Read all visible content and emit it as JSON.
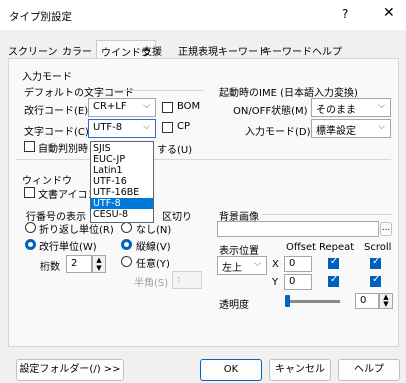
{
  "window": {
    "title": "タイプ別設定",
    "help": "?",
    "close": "✕"
  },
  "tabs": [
    "スクリーン",
    "カラー",
    "ウインドウ",
    "支援",
    "正規表現キーワード",
    "キーワードヘルプ"
  ],
  "input_mode": {
    "section_title": "入力モード",
    "default_charset_title": "デフォルトの文字コード",
    "newline_label": "改行コード(E)",
    "newline_value": "CR+LF",
    "bom_label": "BOM",
    "charset_label": "文字コード(C)",
    "charset_value": "UTF-8",
    "cp_label": "CP",
    "auto_detect_label": "自動判別時",
    "auto_detect_tail": "する(U)",
    "charset_options": [
      "SJIS",
      "EUC-JP",
      "Latin1",
      "UTF-16",
      "UTF-16BE",
      "UTF-8",
      "CESU-8"
    ],
    "charset_selected_index": 5
  },
  "ime": {
    "title": "起動時のIME (日本語入力変換)",
    "onoff_label": "ON/OFF状態(M)",
    "onoff_value": "そのまま",
    "mode_label": "入力モード(D)",
    "mode_value": "標準設定"
  },
  "window_section": {
    "title": "ウィンドウ",
    "doc_icon_label": "文書アイコン",
    "linenum_title": "行番号の表示",
    "wrap_title": "折り返し単位",
    "wrap_label": "折り返し単位(R)",
    "newline_unit_label": "改行単位(W)",
    "digits_label": "桁数",
    "digits_value": "2",
    "split_title": "区切り",
    "none_label": "なし(N)",
    "vertical_label": "縦線(V)",
    "any_label": "任意(Y)",
    "halfwidth_label": "半角(S)",
    "halfwidth_value": ":"
  },
  "background": {
    "title": "背景画像",
    "path_value": "",
    "browse_label": "...",
    "position_label": "表示位置",
    "offset_label": "Offset",
    "repeat_label": "Repeat",
    "scroll_label": "Scroll",
    "position_value": "左上",
    "x_label": "X",
    "x_value": "0",
    "y_label": "Y",
    "y_value": "0",
    "repeat_x": true,
    "scroll_x": true,
    "repeat_y": true,
    "scroll_y": true,
    "opacity_label": "透明度",
    "opacity_value": "0"
  },
  "footer": {
    "settings_folder": "設定フォルダー(/) >>",
    "ok": "OK",
    "cancel": "キャンセル",
    "help": "ヘルプ"
  },
  "colors": {
    "accent": "#0060c0",
    "selection": "#0078d7"
  }
}
